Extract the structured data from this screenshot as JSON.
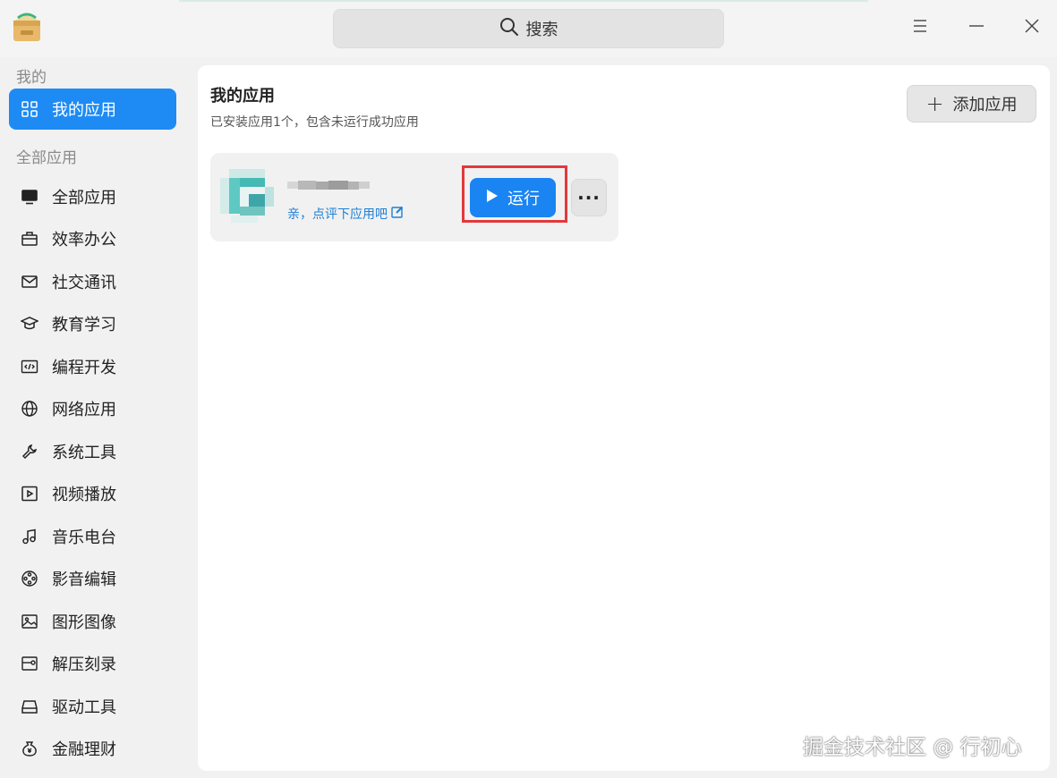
{
  "search": {
    "label": "搜索"
  },
  "sidebar": {
    "section_mine": "我的",
    "my_apps": "我的应用",
    "section_all": "全部应用",
    "items": [
      {
        "label": "全部应用",
        "icon": "monitor-icon"
      },
      {
        "label": "效率办公",
        "icon": "briefcase-icon"
      },
      {
        "label": "社交通讯",
        "icon": "mail-icon"
      },
      {
        "label": "教育学习",
        "icon": "graduation-cap-icon"
      },
      {
        "label": "编程开发",
        "icon": "code-icon"
      },
      {
        "label": "网络应用",
        "icon": "globe-icon"
      },
      {
        "label": "系统工具",
        "icon": "wrench-icon"
      },
      {
        "label": "视频播放",
        "icon": "video-play-icon"
      },
      {
        "label": "音乐电台",
        "icon": "music-note-icon"
      },
      {
        "label": "影音编辑",
        "icon": "film-reel-icon"
      },
      {
        "label": "图形图像",
        "icon": "image-icon"
      },
      {
        "label": "解压刻录",
        "icon": "archive-icon"
      },
      {
        "label": "驱动工具",
        "icon": "drive-icon"
      },
      {
        "label": "金融理财",
        "icon": "money-bag-icon"
      }
    ]
  },
  "main": {
    "title": "我的应用",
    "subtitle": "已安装应用1个，包含未运行成功应用",
    "add_button": "添加应用",
    "app": {
      "rate_text": "亲，点评下应用吧",
      "run_button": "运行",
      "more_button": "···"
    }
  },
  "watermark": "掘金技术社区 @ 行初心",
  "colors": {
    "accent": "#1e8bf5",
    "highlight": "#e3393b"
  }
}
